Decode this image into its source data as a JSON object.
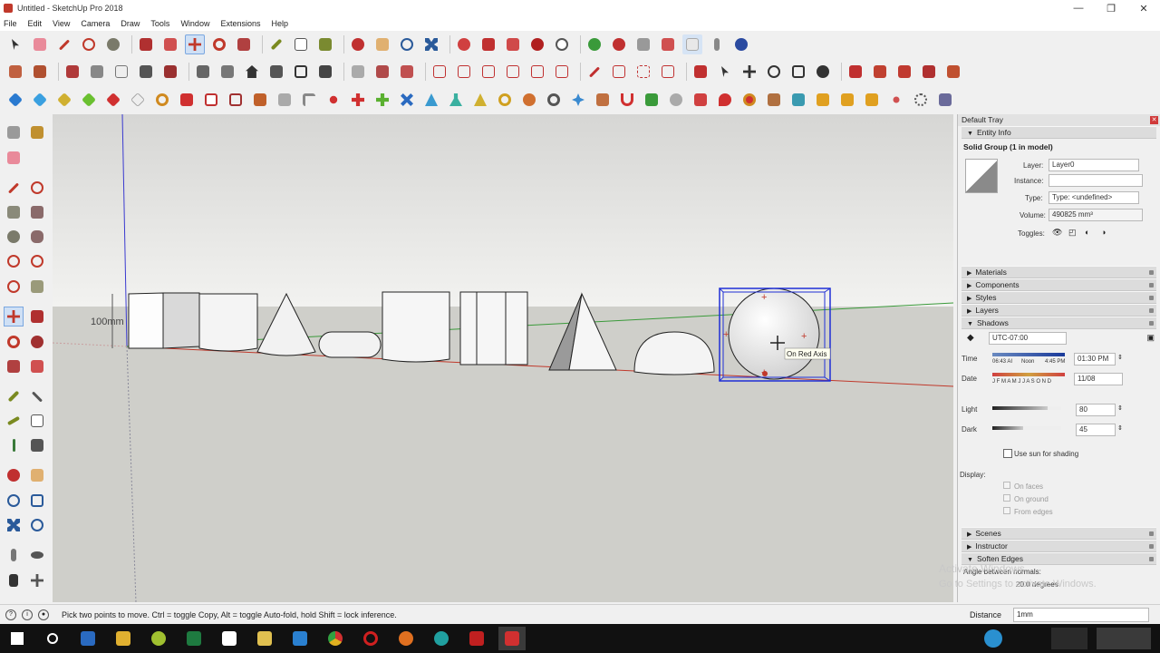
{
  "window": {
    "title": "Untitled - SketchUp Pro 2018",
    "minimize": "—",
    "maximize": "❐",
    "close": "✕"
  },
  "menu": [
    "File",
    "Edit",
    "View",
    "Camera",
    "Draw",
    "Tools",
    "Window",
    "Extensions",
    "Help"
  ],
  "viewport": {
    "dimension_label": "100mm",
    "tooltip": "On Red Axis"
  },
  "tray": {
    "title": "Default Tray",
    "entity_info": {
      "header": "Entity Info",
      "selection": "Solid Group (1 in model)",
      "layer_label": "Layer:",
      "layer_value": "Layer0",
      "instance_label": "Instance:",
      "instance_value": "",
      "type_label": "Type:",
      "type_value": "Type: <undefined>",
      "volume_label": "Volume:",
      "volume_value": "490825 mm³",
      "toggles_label": "Toggles:"
    },
    "sections": [
      "Materials",
      "Components",
      "Styles",
      "Layers"
    ],
    "shadows": {
      "header": "Shadows",
      "timezone": "UTC-07:00",
      "time_label": "Time",
      "time_start": "06:43 AI",
      "time_noon": "Noon",
      "time_end": "4:45 PM",
      "time_value": "01:30 PM",
      "date_label": "Date",
      "months": "J F M A M J J A S O N D",
      "date_value": "11/08",
      "light_label": "Light",
      "light_value": "80",
      "light_level": 0.8,
      "dark_label": "Dark",
      "dark_value": "45",
      "dark_level": 0.45,
      "use_sun": "Use sun for shading",
      "display_label": "Display:",
      "on_faces": "On faces",
      "on_ground": "On ground",
      "from_edges": "From edges"
    },
    "bottom_sections": [
      "Scenes",
      "Instructor",
      "Soften Edges"
    ],
    "soften_label": "Angle between normals:",
    "soften_value": "20.0  degrees"
  },
  "status": {
    "message": "Pick two points to move.  Ctrl = toggle Copy, Alt = toggle Auto-fold, hold Shift = lock inference.",
    "distance_label": "Distance",
    "distance_value": "1mm"
  },
  "watermark": {
    "line1": "Activate Windows",
    "line2": "Go to Settings to activate Windows."
  },
  "colors": {
    "selection_blue": "#1f2fd6",
    "red_axis": "#c0392b",
    "green_axis": "#3a9a3a",
    "blue_axis": "#3a3ad0",
    "sky": "#e6e6e6",
    "ground": "#cfcfca"
  }
}
